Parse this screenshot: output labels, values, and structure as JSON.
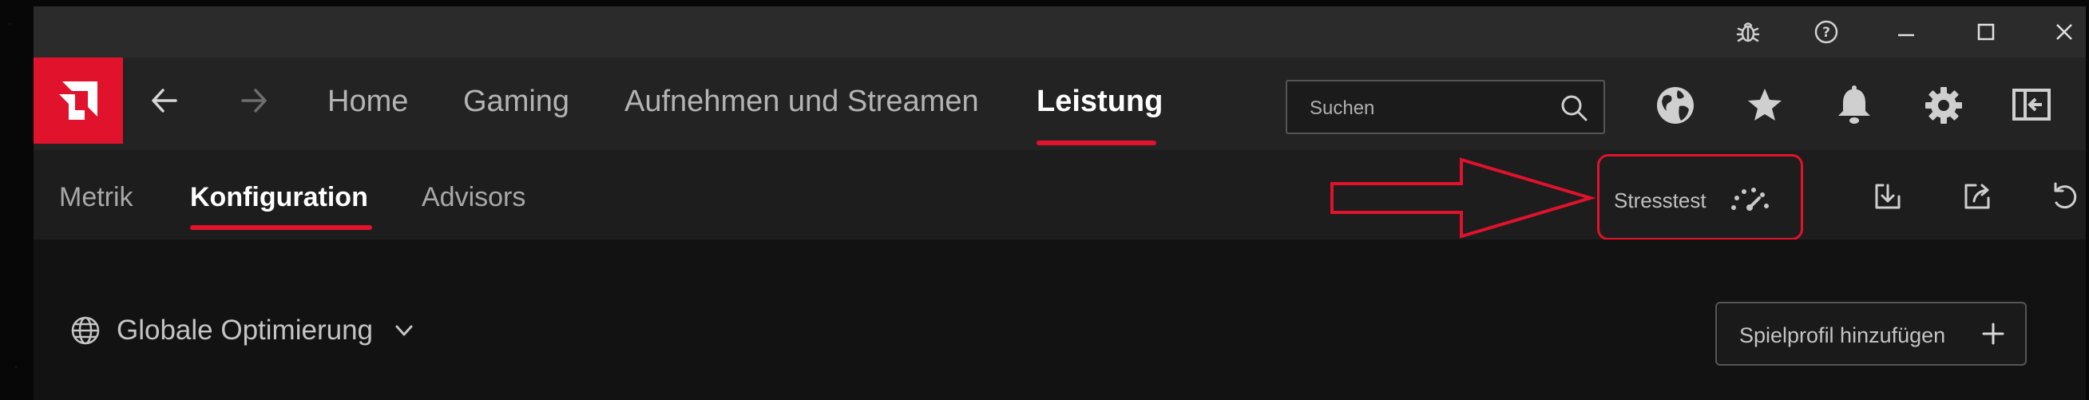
{
  "titlebar": {
    "icons": [
      "bug-icon",
      "help-icon",
      "minimize-icon",
      "maximize-icon",
      "close-icon"
    ]
  },
  "nav": {
    "items": [
      {
        "label": "Home"
      },
      {
        "label": "Gaming"
      },
      {
        "label": "Aufnehmen und Streamen"
      },
      {
        "label": "Leistung",
        "active": true
      }
    ],
    "search_placeholder": "Suchen",
    "right_icons": [
      "globe-icon",
      "star-icon",
      "bell-icon",
      "gear-icon",
      "sidebar-toggle-icon"
    ]
  },
  "subnav": {
    "items": [
      {
        "label": "Metrik"
      },
      {
        "label": "Konfiguration",
        "active": true
      },
      {
        "label": "Advisors"
      }
    ],
    "stresstest_label": "Stresstest",
    "right_icons": [
      "import-icon",
      "export-icon",
      "reset-icon"
    ]
  },
  "content": {
    "profile_label": "Globale Optimierung",
    "add_profile_label": "Spielprofil hinzufügen"
  },
  "colors": {
    "accent": "#e1122b",
    "titlebar_bg": "#2b2b2b",
    "nav_bg": "#232323",
    "subnav_bg": "#1d1d1d",
    "content_bg": "#121212",
    "text_inactive": "#b4b4b4"
  }
}
